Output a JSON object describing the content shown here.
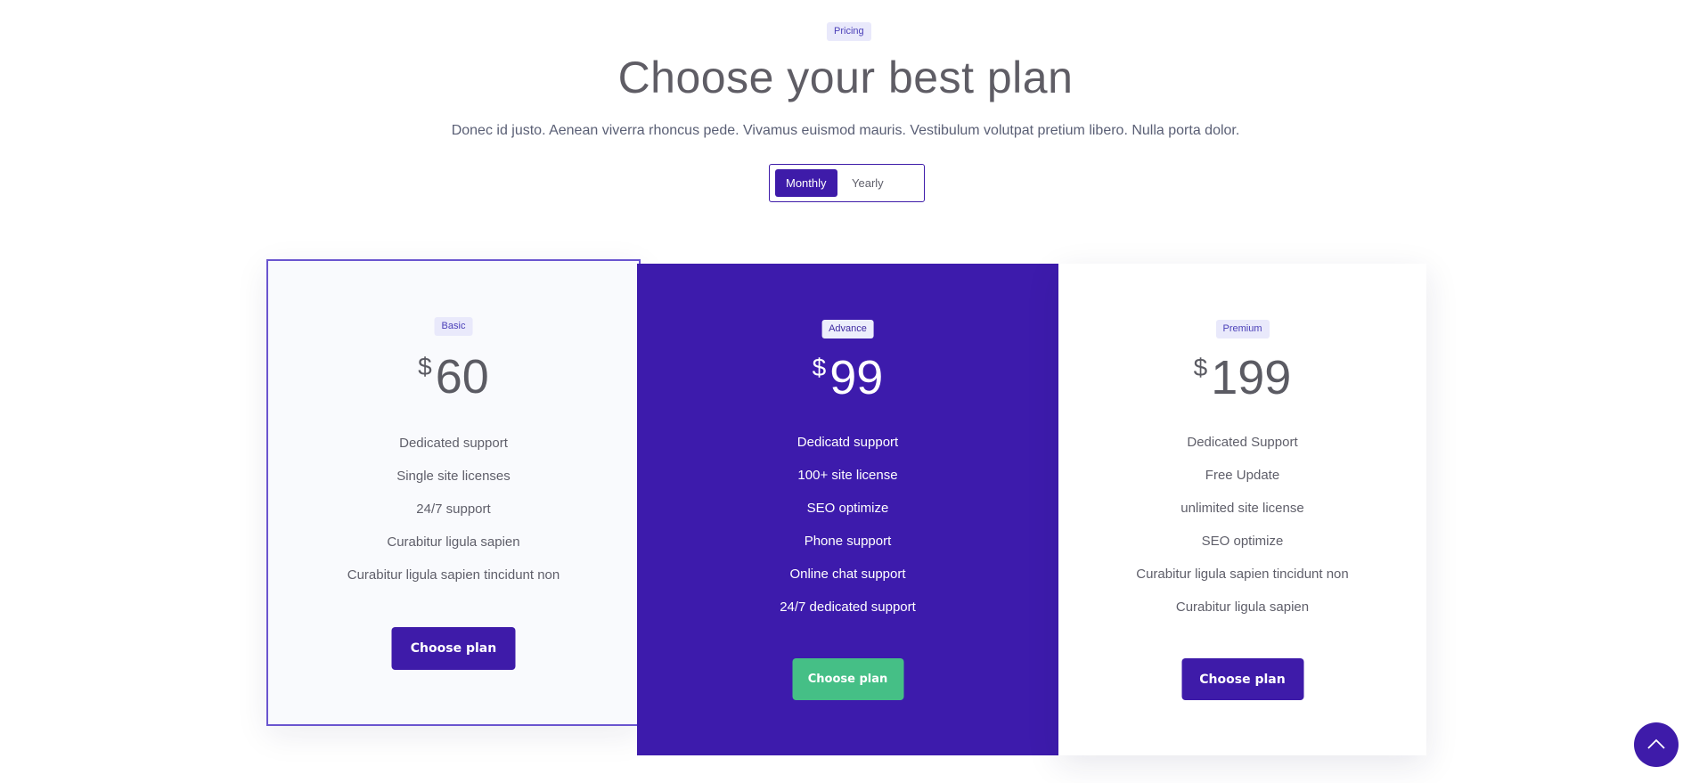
{
  "header": {
    "badge": "Pricing",
    "title": "Choose your best plan",
    "subtitle": "Donec id justo. Aenean viverra rhoncus pede. Vivamus euismod mauris. Vestibulum volutpat pretium libero. Nulla porta dolor."
  },
  "toggle": {
    "options": [
      "Monthly",
      "Yearly"
    ],
    "selected": "Monthly"
  },
  "plans": [
    {
      "name": "Basic",
      "currency": "$",
      "price": "60",
      "features": [
        "Dedicated support",
        "Single site licenses",
        "24/7 support",
        "Curabitur ligula sapien",
        "Curabitur ligula sapien tincidunt non"
      ],
      "button": "Choose plan"
    },
    {
      "name": "Advance",
      "currency": "$",
      "price": "99",
      "features": [
        "Dedicatd support",
        "100+ site license",
        "SEO optimize",
        "Phone support",
        "Online chat support",
        "24/7 dedicated support"
      ],
      "button": "Choose plan"
    },
    {
      "name": "Premium",
      "currency": "$",
      "price": "199",
      "features": [
        "Dedicated Support",
        "Free Update",
        "unlimited site license",
        "SEO optimize",
        "Curabitur ligula sapien tincidunt non",
        "Curabitur ligula sapien"
      ],
      "button": "Choose plan"
    }
  ],
  "scroll_top": {
    "icon": "chevron-up-icon"
  },
  "colors": {
    "primary": "#3e1ba9",
    "accent_green": "#45bf86",
    "badge_bg": "#e9e9fb"
  }
}
